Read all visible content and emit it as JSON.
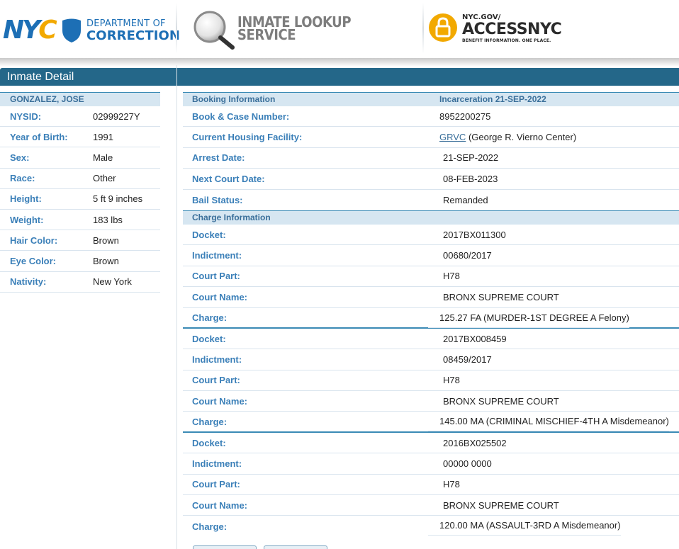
{
  "header": {
    "nyc_logo_text": [
      "NY",
      "C"
    ],
    "doc_line1": "DEPARTMENT OF",
    "doc_line2": "CORRECTION",
    "service_line1": "INMATE LOOKUP",
    "service_line2": "SERVICE",
    "access_line1": "NYC.GOV/",
    "access_line2": "ACCESSNYC",
    "access_line3": "BENEFIT INFORMATION. ONE PLACE."
  },
  "title": "Inmate Detail",
  "inmate": {
    "name": "GONZALEZ, JOSE",
    "fields": [
      {
        "label": "NYSID:",
        "value": "02999227Y"
      },
      {
        "label": "Year of Birth:",
        "value": "1991"
      },
      {
        "label": "Sex:",
        "value": "Male"
      },
      {
        "label": "Race:",
        "value": "Other"
      },
      {
        "label": "Height:",
        "value": "5 ft 9 inches"
      },
      {
        "label": "Weight:",
        "value": "183 lbs"
      },
      {
        "label": "Hair Color:",
        "value": "Brown"
      },
      {
        "label": "Eye Color:",
        "value": "Brown"
      },
      {
        "label": "Nativity:",
        "value": "New York"
      }
    ]
  },
  "booking": {
    "header": "Booking Information",
    "incarceration": "Incarceration 21-SEP-2022",
    "book_label": "Book & Case Number:",
    "book_value": "8952200275",
    "facility_label": "Current Housing Facility:",
    "facility_code": "GRVC",
    "facility_name": "(George R. Vierno Center)",
    "arrest_label": "Arrest Date:",
    "arrest_value": "21-SEP-2022",
    "court_label": "Next Court Date:",
    "court_value": "08-FEB-2023",
    "bail_label": "Bail Status:",
    "bail_value": "Remanded"
  },
  "charges": {
    "header": "Charge Information",
    "labels": {
      "docket": "Docket:",
      "indictment": "Indictment:",
      "court_part": "Court Part:",
      "court_name": "Court Name:",
      "charge": "Charge:"
    },
    "items": [
      {
        "docket": "2017BX011300",
        "indictment": "00680/2017",
        "court_part": "H78",
        "court_name": "BRONX SUPREME COURT",
        "charge": "125.27 FA (MURDER-1ST DEGREE A Felony)"
      },
      {
        "docket": "2017BX008459",
        "indictment": "08459/2017",
        "court_part": "H78",
        "court_name": "BRONX SUPREME COURT",
        "charge": "145.00 MA (CRIMINAL MISCHIEF-4TH A Misdemeanor)"
      },
      {
        "docket": "2016BX025502",
        "indictment": "00000 0000",
        "court_part": "H78",
        "court_name": "BRONX SUPREME COURT",
        "charge": "120.00 MA (ASSAULT-3RD A Misdemeanor)"
      }
    ]
  }
}
